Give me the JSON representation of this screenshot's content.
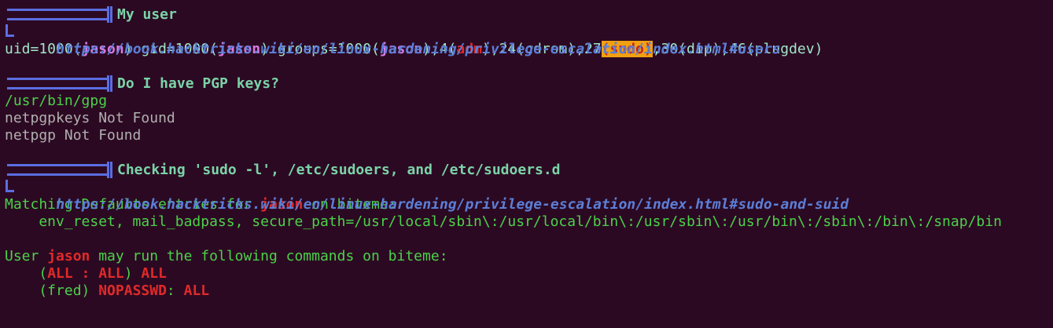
{
  "colors": {
    "background": "#2c0922",
    "header_bar": "#5b6ee1",
    "section_title": "#7bd3a8",
    "link": "#5b7fd8",
    "user": "#d57ae0",
    "danger": "#e02a2a",
    "highlight_bg": "#f0a010",
    "green": "#4ad24a",
    "grey": "#b0b0b0"
  },
  "sections": [
    {
      "title": "My user",
      "link": "https://book.hacktricks.wiki/en/linux-hardening/privilege-escalation/index.html#users",
      "id_line": {
        "p1": "uid=1000(",
        "u1": "jason",
        "p2": ") gid=1000(",
        "u2": "jason",
        "p3": ") groups=1000(",
        "u3": "jason",
        "p4": "),4(",
        "adm": "adm",
        "p5": "),24(cdrom),27",
        "sudo": "(sudo)",
        "p6": ",30(dip),46(plugdev)"
      }
    },
    {
      "title": "Do I have PGP keys?",
      "lines": [
        "/usr/bin/gpg",
        "netpgpkeys Not Found",
        "netpgp Not Found"
      ]
    },
    {
      "title": "Checking 'sudo -l', /etc/sudoers, and /etc/sudoers.d",
      "link": "https://book.hacktricks.wiki/en/linux-hardening/privilege-escalation/index.html#sudo-and-suid",
      "defaults": {
        "pre": "Matching Defaults entries for ",
        "user": "jason",
        "post": " on biteme:",
        "entries": "    env_reset, mail_badpass, secure_path=/usr/local/sbin\\:/usr/local/bin\\:/usr/sbin\\:/usr/bin\\:/sbin\\:/bin\\:/snap/bin"
      },
      "may_run": {
        "pre": "User ",
        "user": "jason",
        "post": " may run the following commands on biteme:"
      },
      "rule1": {
        "indent": "    (",
        "runas": "ALL : ALL",
        "close": ") ",
        "cmd": "ALL"
      },
      "rule2": {
        "indent": "    (fred) ",
        "tag": "NOPASSWD",
        "sep": ": ",
        "cmd": "ALL"
      }
    }
  ]
}
